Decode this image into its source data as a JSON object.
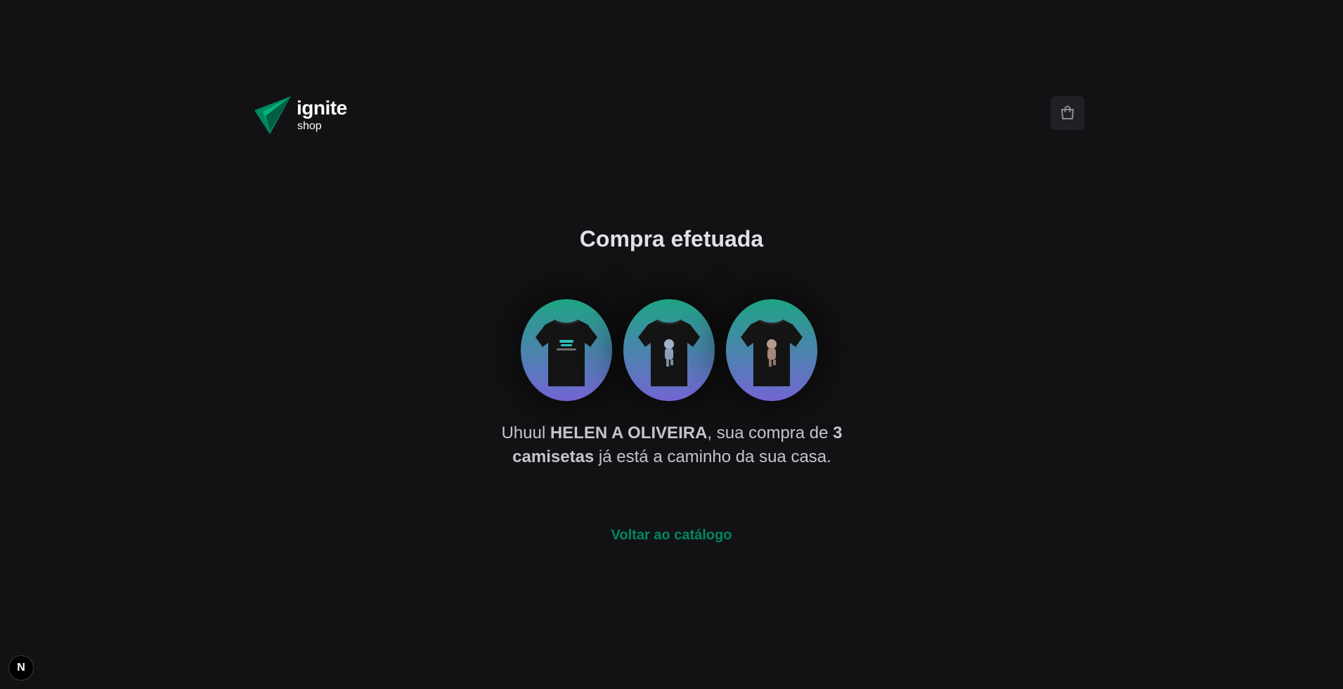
{
  "header": {
    "logo": {
      "title": "ignite",
      "subtitle": "shop",
      "icon": "paper-plane-logo-icon",
      "colors": [
        "#00875f",
        "#00b37e"
      ]
    },
    "cart": {
      "icon": "shopping-bag-icon",
      "background": "#202024"
    }
  },
  "main": {
    "title": "Compra efetuada",
    "images": [
      {
        "alt": "camiseta",
        "print": "logo-print"
      },
      {
        "alt": "camiseta",
        "print": "astronaut-print"
      },
      {
        "alt": "camiseta",
        "print": "astronaut-print"
      }
    ],
    "message": {
      "greeting": "Uhuul ",
      "customer_name": "HELEN A OLIVEIRA",
      "middle": ", sua compra de ",
      "quantity": "3 camisetas",
      "end": " já está a caminho da sua casa."
    },
    "back_link": "Voltar ao catálogo"
  },
  "dev_badge": {
    "label": "N"
  },
  "colors": {
    "background": "#121214",
    "title": "#e1e1e6",
    "text": "#c4c4cc",
    "accent": "#00875f",
    "gradient_top": "#1ea483",
    "gradient_bottom": "#7465d4"
  }
}
